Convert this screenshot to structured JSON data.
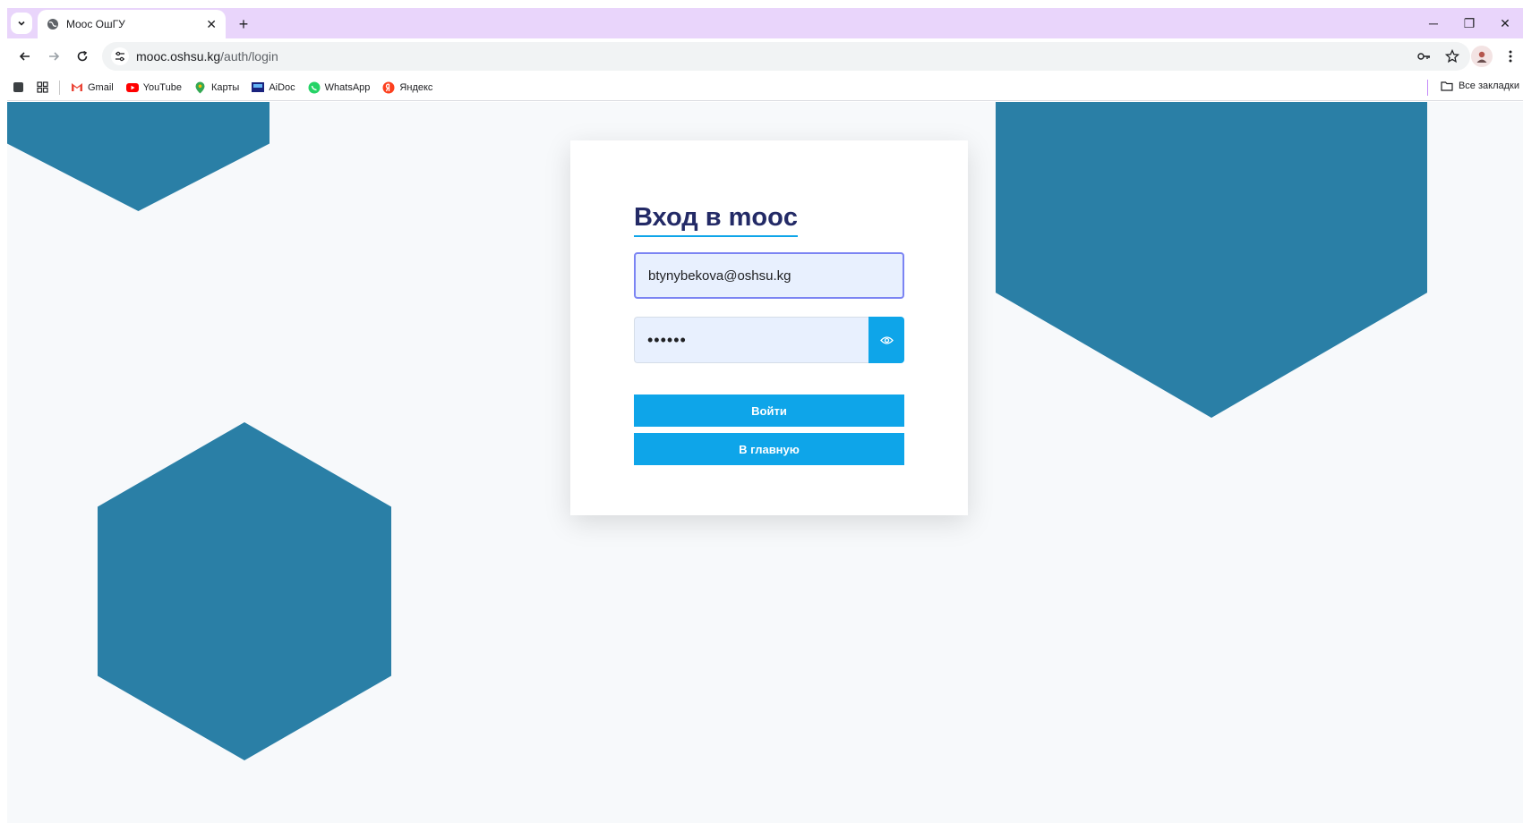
{
  "browser": {
    "tab": {
      "title": "Mooc ОшГУ",
      "close_glyph": "✕",
      "favicon": "globe-icon"
    },
    "new_tab_glyph": "+",
    "window_controls": {
      "minimize": "─",
      "restore": "❐",
      "close": "✕"
    },
    "address": {
      "host": "mooc.oshsu.kg",
      "path": "/auth/login"
    },
    "bookmarks": [
      {
        "label": "Gmail",
        "icon": "gmail-icon",
        "color": "#ea4335"
      },
      {
        "label": "YouTube",
        "icon": "youtube-icon",
        "color": "#ff0000"
      },
      {
        "label": "Карты",
        "icon": "maps-icon",
        "color": "#34a853"
      },
      {
        "label": "AiDoc",
        "icon": "aidoc-icon",
        "color": "#1a237e"
      },
      {
        "label": "WhatsApp",
        "icon": "whatsapp-icon",
        "color": "#25d366"
      },
      {
        "label": "Яндекс",
        "icon": "yandex-icon",
        "color": "#fc3f1d"
      }
    ],
    "all_bookmarks": "Все закладки"
  },
  "page": {
    "background": "#f7f9fb",
    "hex_color": "#2a7fa6",
    "accent": "#0ea5e9",
    "login": {
      "title": "Вход в mooc",
      "email_value": "btynybekova@oshsu.kg",
      "password_masked": "••••••",
      "submit_label": "Войти",
      "home_label": "В главную"
    }
  }
}
